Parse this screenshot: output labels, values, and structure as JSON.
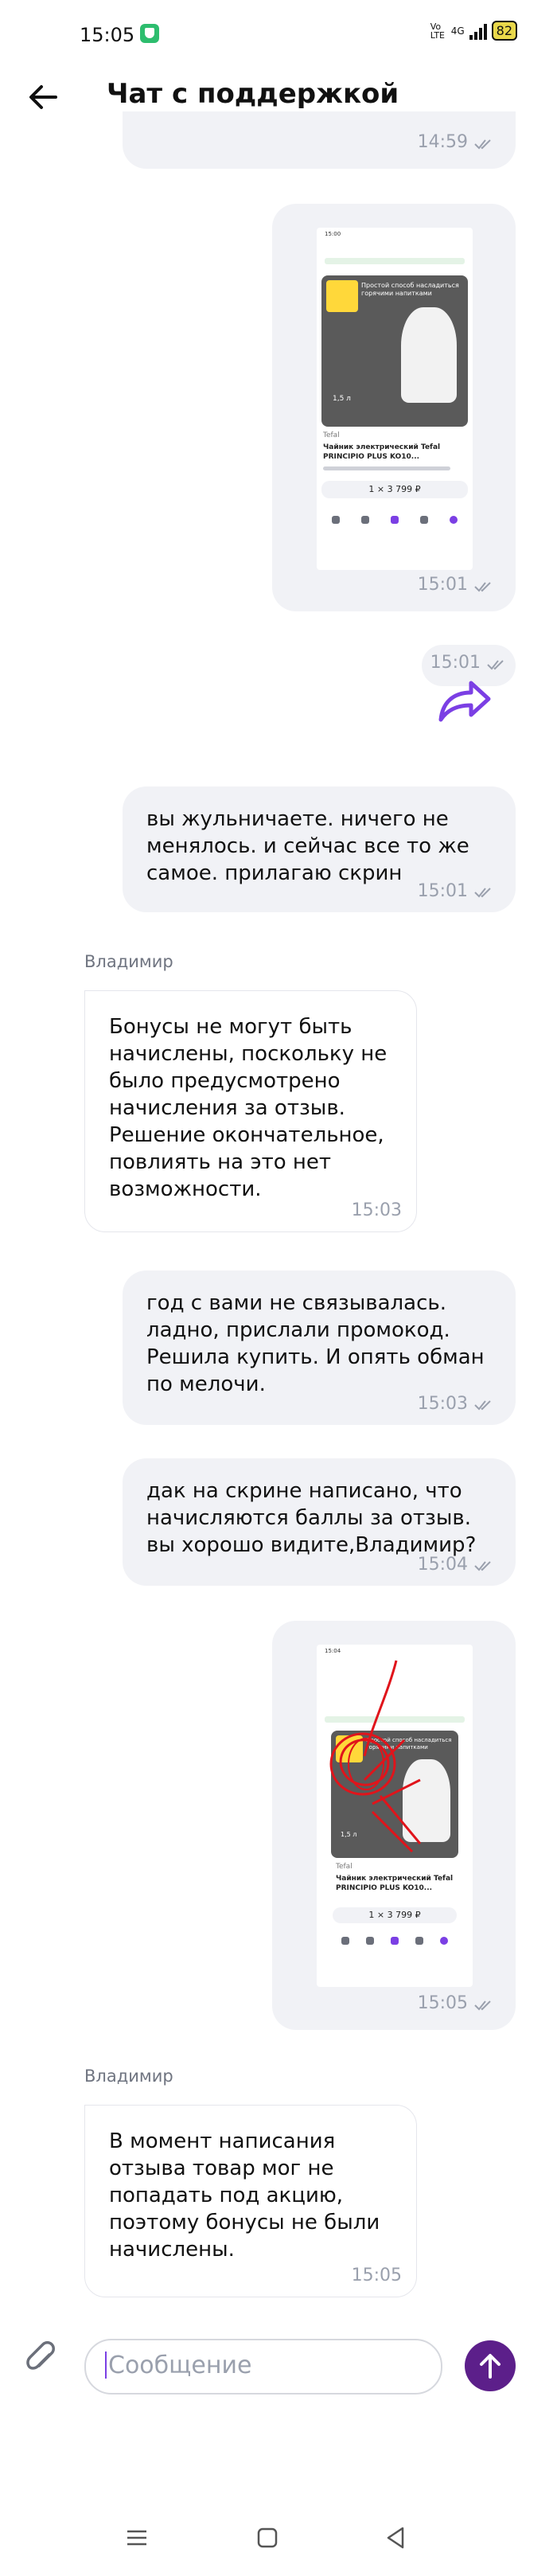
{
  "status_bar": {
    "time": "15:05",
    "network": "4G",
    "volte": "Vo LTE",
    "battery": "82"
  },
  "header": {
    "title": "Чат с поддержкой"
  },
  "messages": [
    {
      "id": "m0",
      "time": "14:59"
    },
    {
      "id": "m1",
      "type": "image",
      "time": "15:01",
      "thumb": {
        "product_brand": "Tefal",
        "product_name": "Чайник электрический Tefal PRINCIPIO PLUS KO10...",
        "price": "1 × 3 799 ₽",
        "banner": "Простой способ насладиться горячими напитками",
        "size": "1,5 л",
        "time": "15:00"
      }
    },
    {
      "id": "m2",
      "type": "forward",
      "time": "15:01"
    },
    {
      "id": "m3",
      "type": "text",
      "text": "вы жульничаете. ничего не менялось. и сейчас все то же самое. прилагаю скрин",
      "time": "15:01"
    },
    {
      "id": "m4",
      "type": "incoming",
      "sender": "Владимир",
      "text": "Бонусы не могут быть начислены, поскольку не было предусмотрено начисления за отзыв. Решение окончательное, повлиять на это нет возможности.",
      "time": "15:03"
    },
    {
      "id": "m5",
      "type": "text",
      "text": "год с вами не связывалась. ладно, прислали промокод. Решила купить. И опять обман по мелочи.",
      "time": "15:03"
    },
    {
      "id": "m6",
      "type": "text",
      "text": "дак на скрине написано, что начисляются баллы за отзыв. вы хорошо видите,Владимир?",
      "time": "15:04"
    },
    {
      "id": "m7",
      "type": "image",
      "time": "15:05",
      "thumb": {
        "product_brand": "Tefal",
        "product_name": "Чайник электрический Tefal PRINCIPIO PLUS KO10...",
        "price": "1 × 3 799 ₽",
        "banner": "Простой способ насладиться горячими напитками",
        "size": "1,5 л",
        "time": "15:04"
      }
    },
    {
      "id": "m8",
      "type": "incoming",
      "sender": "Владимир",
      "text": "В момент написания отзыва товар мог не попадать под акцию, поэтому бонусы не были начислены.",
      "time": "15:05"
    }
  ],
  "composer": {
    "placeholder": "Сообщение"
  },
  "colors": {
    "accent": "#5c1f8a",
    "bubble_out": "#f1f2f6",
    "check": "#9aa0ad",
    "forward": "#7b3fe4",
    "annotation": "#e0141b"
  }
}
